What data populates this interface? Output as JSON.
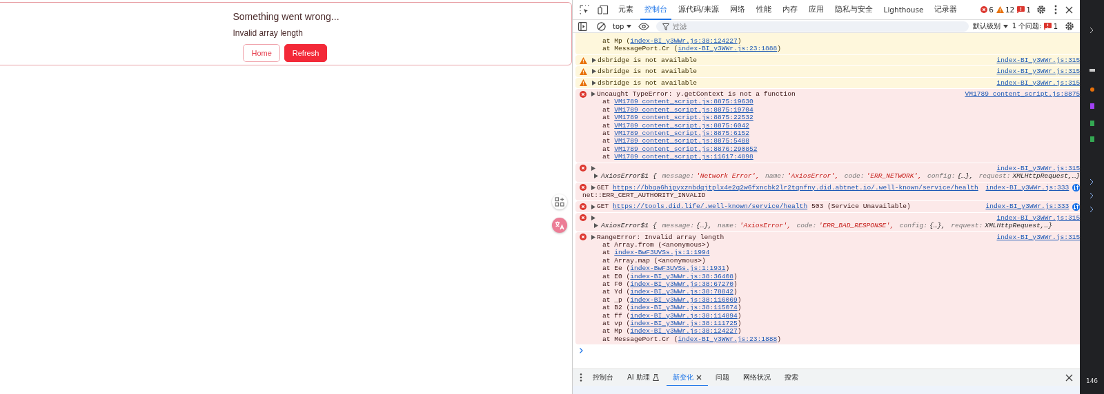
{
  "error_page": {
    "title": "Something went wrong...",
    "message": "Invalid array length",
    "buttons": [
      {
        "label": "Home",
        "kind": "secondary"
      },
      {
        "label": "Refresh",
        "kind": "primary"
      }
    ]
  },
  "devtools": {
    "tabs": [
      {
        "label": "元素",
        "selected": false
      },
      {
        "label": "控制台",
        "selected": true
      },
      {
        "label": "源代码/来源",
        "selected": false
      },
      {
        "label": "网络",
        "selected": false
      },
      {
        "label": "性能",
        "selected": false
      },
      {
        "label": "内存",
        "selected": false
      },
      {
        "label": "应用",
        "selected": false
      },
      {
        "label": "隐私与安全",
        "selected": false
      },
      {
        "label": "Lighthouse",
        "selected": false
      },
      {
        "label": "记录器",
        "selected": false
      }
    ],
    "counts": {
      "errors": "6",
      "warnings": "12",
      "issues": "1"
    },
    "context": "top",
    "filter": {
      "placeholder": "过滤"
    },
    "level": "默认级别",
    "issues_label": "1 个问题:",
    "issues_count": "1",
    "messages": [
      {
        "kind": "continuation",
        "lines": [
          [
            {
              "text": "at Mp (",
              "kind": "plain"
            },
            {
              "text": "index-BI_y3WWr.js:38:124227",
              "kind": "link"
            },
            {
              "text": ")",
              "kind": "plain"
            }
          ],
          [
            {
              "text": "at MessagePort.Cr (",
              "kind": "plain"
            },
            {
              "text": "index-BI_y3WWr.js:23:1888",
              "kind": "link"
            },
            {
              "text": ")",
              "kind": "plain"
            }
          ]
        ]
      },
      {
        "kind": "warning",
        "header": [
          {
            "text": "dsbridge is not available",
            "kind": "plain"
          }
        ],
        "source": "index-BI_y3WWr.js:315",
        "network": false
      },
      {
        "kind": "warning",
        "header": [
          {
            "text": "dsbridge is not available",
            "kind": "plain"
          }
        ],
        "source": "index-BI_y3WWr.js:315",
        "network": false
      },
      {
        "kind": "warning",
        "header": [
          {
            "text": "dsbridge is not available",
            "kind": "plain"
          }
        ],
        "source": "index-BI_y3WWr.js:315",
        "network": false
      },
      {
        "kind": "error",
        "header": [
          {
            "text": "Uncaught TypeError: y.getContext is not a function",
            "kind": "plain"
          }
        ],
        "source": "VM1789 content_script.js:8875",
        "network": false,
        "lines": [
          [
            {
              "text": "at ",
              "kind": "plain"
            },
            {
              "text": "VM1789 content_script.js:8875:19630",
              "kind": "link"
            }
          ],
          [
            {
              "text": "at ",
              "kind": "plain"
            },
            {
              "text": "VM1789 content_script.js:8875:19704",
              "kind": "link"
            }
          ],
          [
            {
              "text": "at ",
              "kind": "plain"
            },
            {
              "text": "VM1789 content_script.js:8875:22532",
              "kind": "link"
            }
          ],
          [
            {
              "text": "at ",
              "kind": "plain"
            },
            {
              "text": "VM1789 content_script.js:8875:6042",
              "kind": "link"
            }
          ],
          [
            {
              "text": "at ",
              "kind": "plain"
            },
            {
              "text": "VM1789 content_script.js:8875:6152",
              "kind": "link"
            }
          ],
          [
            {
              "text": "at ",
              "kind": "plain"
            },
            {
              "text": "VM1789 content_script.js:8875:5488",
              "kind": "link"
            }
          ],
          [
            {
              "text": "at ",
              "kind": "plain"
            },
            {
              "text": "VM1789 content_script.js:8876:290852",
              "kind": "link"
            }
          ],
          [
            {
              "text": "at ",
              "kind": "plain"
            },
            {
              "text": "VM1789 content_script.js:11617:4898",
              "kind": "link"
            }
          ]
        ]
      },
      {
        "kind": "error",
        "source": "index-BI_y3WWr.js:315",
        "network": false,
        "lines": [
          [
            {
              "text": "AxiosError$1",
              "kind": "class"
            },
            {
              "text": "{",
              "kind": "punct"
            },
            {
              "text": "message:",
              "kind": "key"
            },
            {
              "text": "'Network Error',",
              "kind": "str"
            },
            {
              "text": "name:",
              "kind": "key"
            },
            {
              "text": "'AxiosError',",
              "kind": "str"
            },
            {
              "text": "code:",
              "kind": "key"
            },
            {
              "text": "'ERR_NETWORK',",
              "kind": "str"
            },
            {
              "text": "config:",
              "kind": "key"
            },
            {
              "text": "{…},",
              "kind": "punct"
            },
            {
              "text": "request:",
              "kind": "key"
            },
            {
              "text": "XMLHttpRequest,",
              "kind": "punct"
            },
            {
              "text": "…}",
              "kind": "punct"
            }
          ]
        ]
      },
      {
        "kind": "error",
        "header": [
          {
            "text": "GET ",
            "kind": "plain"
          },
          {
            "text": "https://bbqa6hipyxznbdqjtplx4e2q2w6fxncbk2lr2tqnfny.did.abtnet.io/.well-known/service/health",
            "kind": "link"
          }
        ],
        "source": "index-BI_y3WWr.js:333",
        "network": true,
        "lines": [
          [
            {
              "text": "net::ERR_CERT_AUTHORITY_INVALID",
              "kind": "plain"
            }
          ]
        ]
      },
      {
        "kind": "error",
        "header": [
          {
            "text": "GET ",
            "kind": "plain"
          },
          {
            "text": "https://tools.did.life/.well-known/service/health",
            "kind": "link"
          },
          {
            "text": " 503 (Service Unavailable)",
            "kind": "plain"
          }
        ],
        "source": "index-BI_y3WWr.js:333",
        "network": true
      },
      {
        "kind": "error",
        "source": "index-BI_y3WWr.js:315",
        "network": false,
        "lines": [
          [
            {
              "text": "AxiosError$1",
              "kind": "class"
            },
            {
              "text": "{",
              "kind": "punct"
            },
            {
              "text": "message:",
              "kind": "key"
            },
            {
              "text": "{…},",
              "kind": "punct"
            },
            {
              "text": "name:",
              "kind": "key"
            },
            {
              "text": "'AxiosError',",
              "kind": "str"
            },
            {
              "text": "code:",
              "kind": "key"
            },
            {
              "text": "'ERR_BAD_RESPONSE',",
              "kind": "str"
            },
            {
              "text": "config:",
              "kind": "key"
            },
            {
              "text": "{…},",
              "kind": "punct"
            },
            {
              "text": "request:",
              "kind": "key"
            },
            {
              "text": "XMLHttpRequest,",
              "kind": "punct"
            },
            {
              "text": "…}",
              "kind": "punct"
            }
          ]
        ]
      },
      {
        "kind": "error",
        "header": [
          {
            "text": "RangeError: Invalid array length",
            "kind": "plain"
          }
        ],
        "source": "index-BI_y3WWr.js:315",
        "network": false,
        "lines": [
          [
            {
              "text": "at Array.from (<anonymous>)",
              "kind": "plain"
            }
          ],
          [
            {
              "text": "at ",
              "kind": "plain"
            },
            {
              "text": "index-BwF3UVSs.js:1:1994",
              "kind": "link"
            }
          ],
          [
            {
              "text": "at Array.map (<anonymous>)",
              "kind": "plain"
            }
          ],
          [
            {
              "text": "at Ee (",
              "kind": "plain"
            },
            {
              "text": "index-BwF3UVSs.js:1:1931",
              "kind": "link"
            },
            {
              "text": ")",
              "kind": "plain"
            }
          ],
          [
            {
              "text": "at E0 (",
              "kind": "plain"
            },
            {
              "text": "index-BI_y3WWr.js:38:36408",
              "kind": "link"
            },
            {
              "text": ")",
              "kind": "plain"
            }
          ],
          [
            {
              "text": "at F0 (",
              "kind": "plain"
            },
            {
              "text": "index-BI_y3WWr.js:38:67270",
              "kind": "link"
            },
            {
              "text": ")",
              "kind": "plain"
            }
          ],
          [
            {
              "text": "at Yd (",
              "kind": "plain"
            },
            {
              "text": "index-BI_y3WWr.js:38:78842",
              "kind": "link"
            },
            {
              "text": ")",
              "kind": "plain"
            }
          ],
          [
            {
              "text": "at _p (",
              "kind": "plain"
            },
            {
              "text": "index-BI_y3WWr.js:38:116069",
              "kind": "link"
            },
            {
              "text": ")",
              "kind": "plain"
            }
          ],
          [
            {
              "text": "at B2 (",
              "kind": "plain"
            },
            {
              "text": "index-BI_y3WWr.js:38:115074",
              "kind": "link"
            },
            {
              "text": ")",
              "kind": "plain"
            }
          ],
          [
            {
              "text": "at ff (",
              "kind": "plain"
            },
            {
              "text": "index-BI_y3WWr.js:38:114894",
              "kind": "link"
            },
            {
              "text": ")",
              "kind": "plain"
            }
          ],
          [
            {
              "text": "at vp (",
              "kind": "plain"
            },
            {
              "text": "index-BI_y3WWr.js:38:111725",
              "kind": "link"
            },
            {
              "text": ")",
              "kind": "plain"
            }
          ],
          [
            {
              "text": "at Mp (",
              "kind": "plain"
            },
            {
              "text": "index-BI_y3WWr.js:38:124227",
              "kind": "link"
            },
            {
              "text": ")",
              "kind": "plain"
            }
          ],
          [
            {
              "text": "at MessagePort.Cr (",
              "kind": "plain"
            },
            {
              "text": "index-BI_y3WWr.js:23:1888",
              "kind": "link"
            },
            {
              "text": ")",
              "kind": "plain"
            }
          ]
        ]
      }
    ],
    "drawer_tabs": [
      {
        "label": "控制台",
        "selected": false,
        "experimental": false,
        "closable": false
      },
      {
        "label": "AI 助理",
        "selected": false,
        "experimental": true,
        "closable": false
      },
      {
        "label": "新变化",
        "selected": true,
        "experimental": false,
        "closable": true
      },
      {
        "label": "问题",
        "selected": false,
        "experimental": false,
        "closable": false
      },
      {
        "label": "网络状况",
        "selected": false,
        "experimental": false,
        "closable": false
      },
      {
        "label": "搜索",
        "selected": false,
        "experimental": false,
        "closable": false
      }
    ]
  },
  "side_strip": {
    "number": "146"
  }
}
